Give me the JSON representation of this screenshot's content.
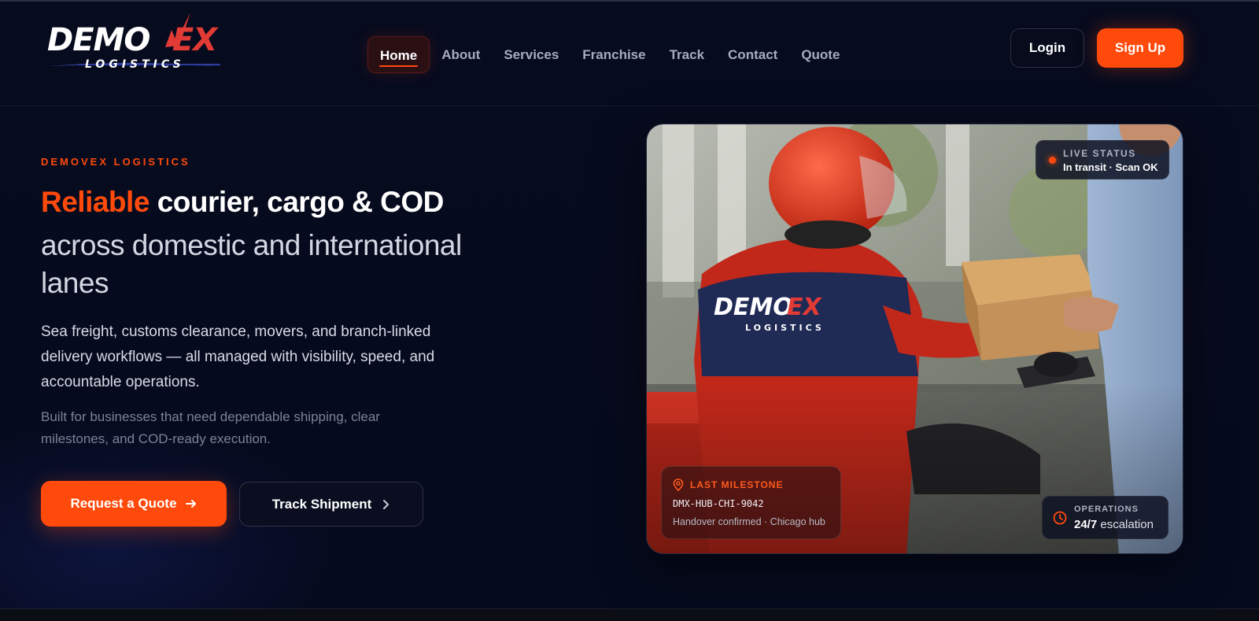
{
  "brand": {
    "logo_word_main": "DEMO",
    "logo_word_v": "V",
    "logo_word_ex": "EX",
    "logo_sub": "LOGISTICS"
  },
  "nav": {
    "items": [
      {
        "label": "Home",
        "active": true
      },
      {
        "label": "About"
      },
      {
        "label": "Services"
      },
      {
        "label": "Franchise"
      },
      {
        "label": "Track"
      },
      {
        "label": "Contact"
      },
      {
        "label": "Quote"
      }
    ],
    "login_label": "Login",
    "signup_label": "Sign Up"
  },
  "hero": {
    "eyebrow": "DEMOVEX LOGISTICS",
    "title_accent": "Reliable",
    "title_rest": "courier, cargo & COD",
    "title_line2": "across domestic and international lanes",
    "description": "Sea freight, customs clearance, movers, and branch-linked delivery workflows — all managed with visibility, speed, and accountable operations.",
    "note": "Built for businesses that need dependable shipping, clear milestones, and COD-ready execution.",
    "cta_primary": "Request a Quote",
    "cta_secondary": "Track Shipment"
  },
  "card": {
    "live_status_label": "LIVE STATUS",
    "live_status_value": "In transit · Scan OK",
    "milestone_label": "LAST MILESTONE",
    "milestone_code": "DMX-HUB-CHI-9042",
    "milestone_detail": "Handover confirmed · Chicago hub",
    "ops_label": "OPERATIONS",
    "ops_value_strong": "24/7",
    "ops_value_rest": "escalation"
  },
  "colors": {
    "accent": "#ff4a0c",
    "background": "#060a1c",
    "logo_red": "#e23a34"
  },
  "icons": {
    "quote_arrow": "arrow-right-icon",
    "track_chevron": "chevron-right-icon",
    "milestone_pin": "map-pin-icon",
    "ops_clock": "clock-icon",
    "live_dot": "status-dot-icon"
  }
}
